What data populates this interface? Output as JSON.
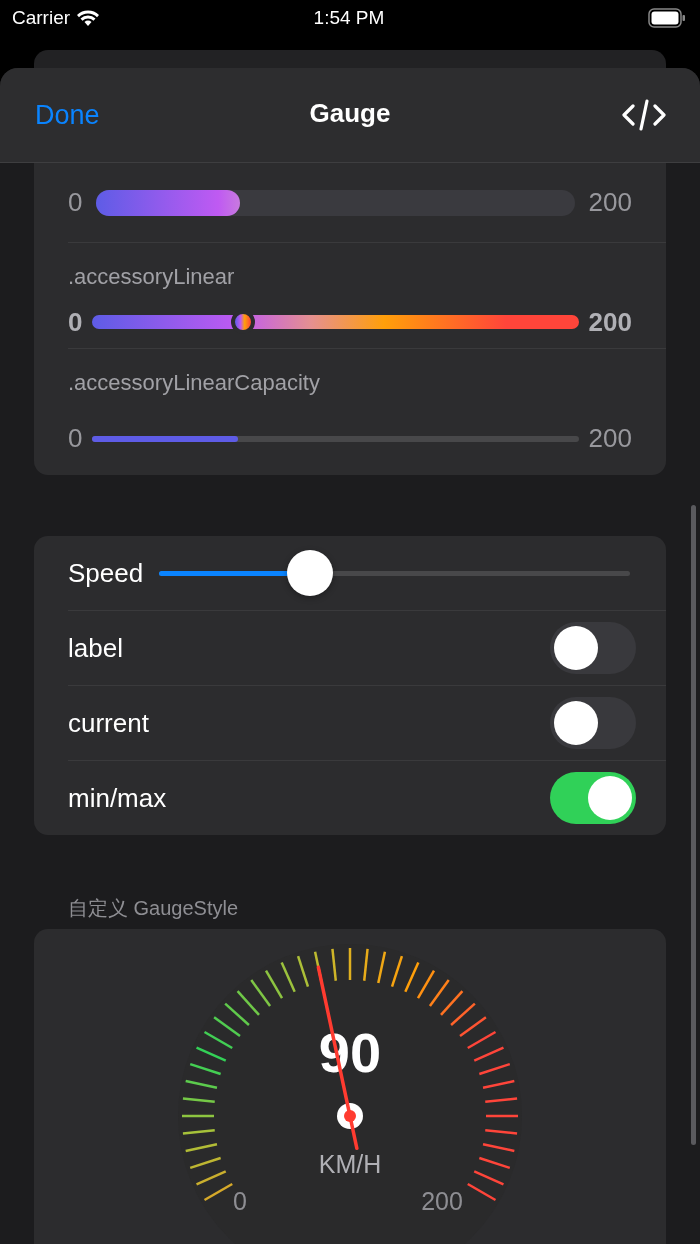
{
  "status_bar": {
    "carrier": "Carrier",
    "time": "1:54 PM"
  },
  "nav": {
    "done": "Done",
    "title": "Gauge"
  },
  "gauges": [
    {
      "kind": "capacity",
      "min": "0",
      "max": "200",
      "level": 0.3
    },
    {
      "kind": "linear",
      "label": ".accessoryLinear",
      "min": "0",
      "max": "200",
      "level": 0.31
    },
    {
      "kind": "linear_capacity",
      "label": ".accessoryLinearCapacity",
      "min": "0",
      "max": "200",
      "level": 0.3
    }
  ],
  "controls": [
    {
      "kind": "slider",
      "label": "Speed",
      "level": 0.32
    },
    {
      "kind": "toggle",
      "label": "label",
      "on": false
    },
    {
      "kind": "toggle",
      "label": "current",
      "on": false
    },
    {
      "kind": "toggle",
      "label": "min/max",
      "on": true
    }
  ],
  "custom_section": {
    "header": "自定义 GaugeStyle",
    "gauge": {
      "value": "90",
      "unit": "KM/H",
      "min": "0",
      "max": "200",
      "level": 0.45
    }
  }
}
